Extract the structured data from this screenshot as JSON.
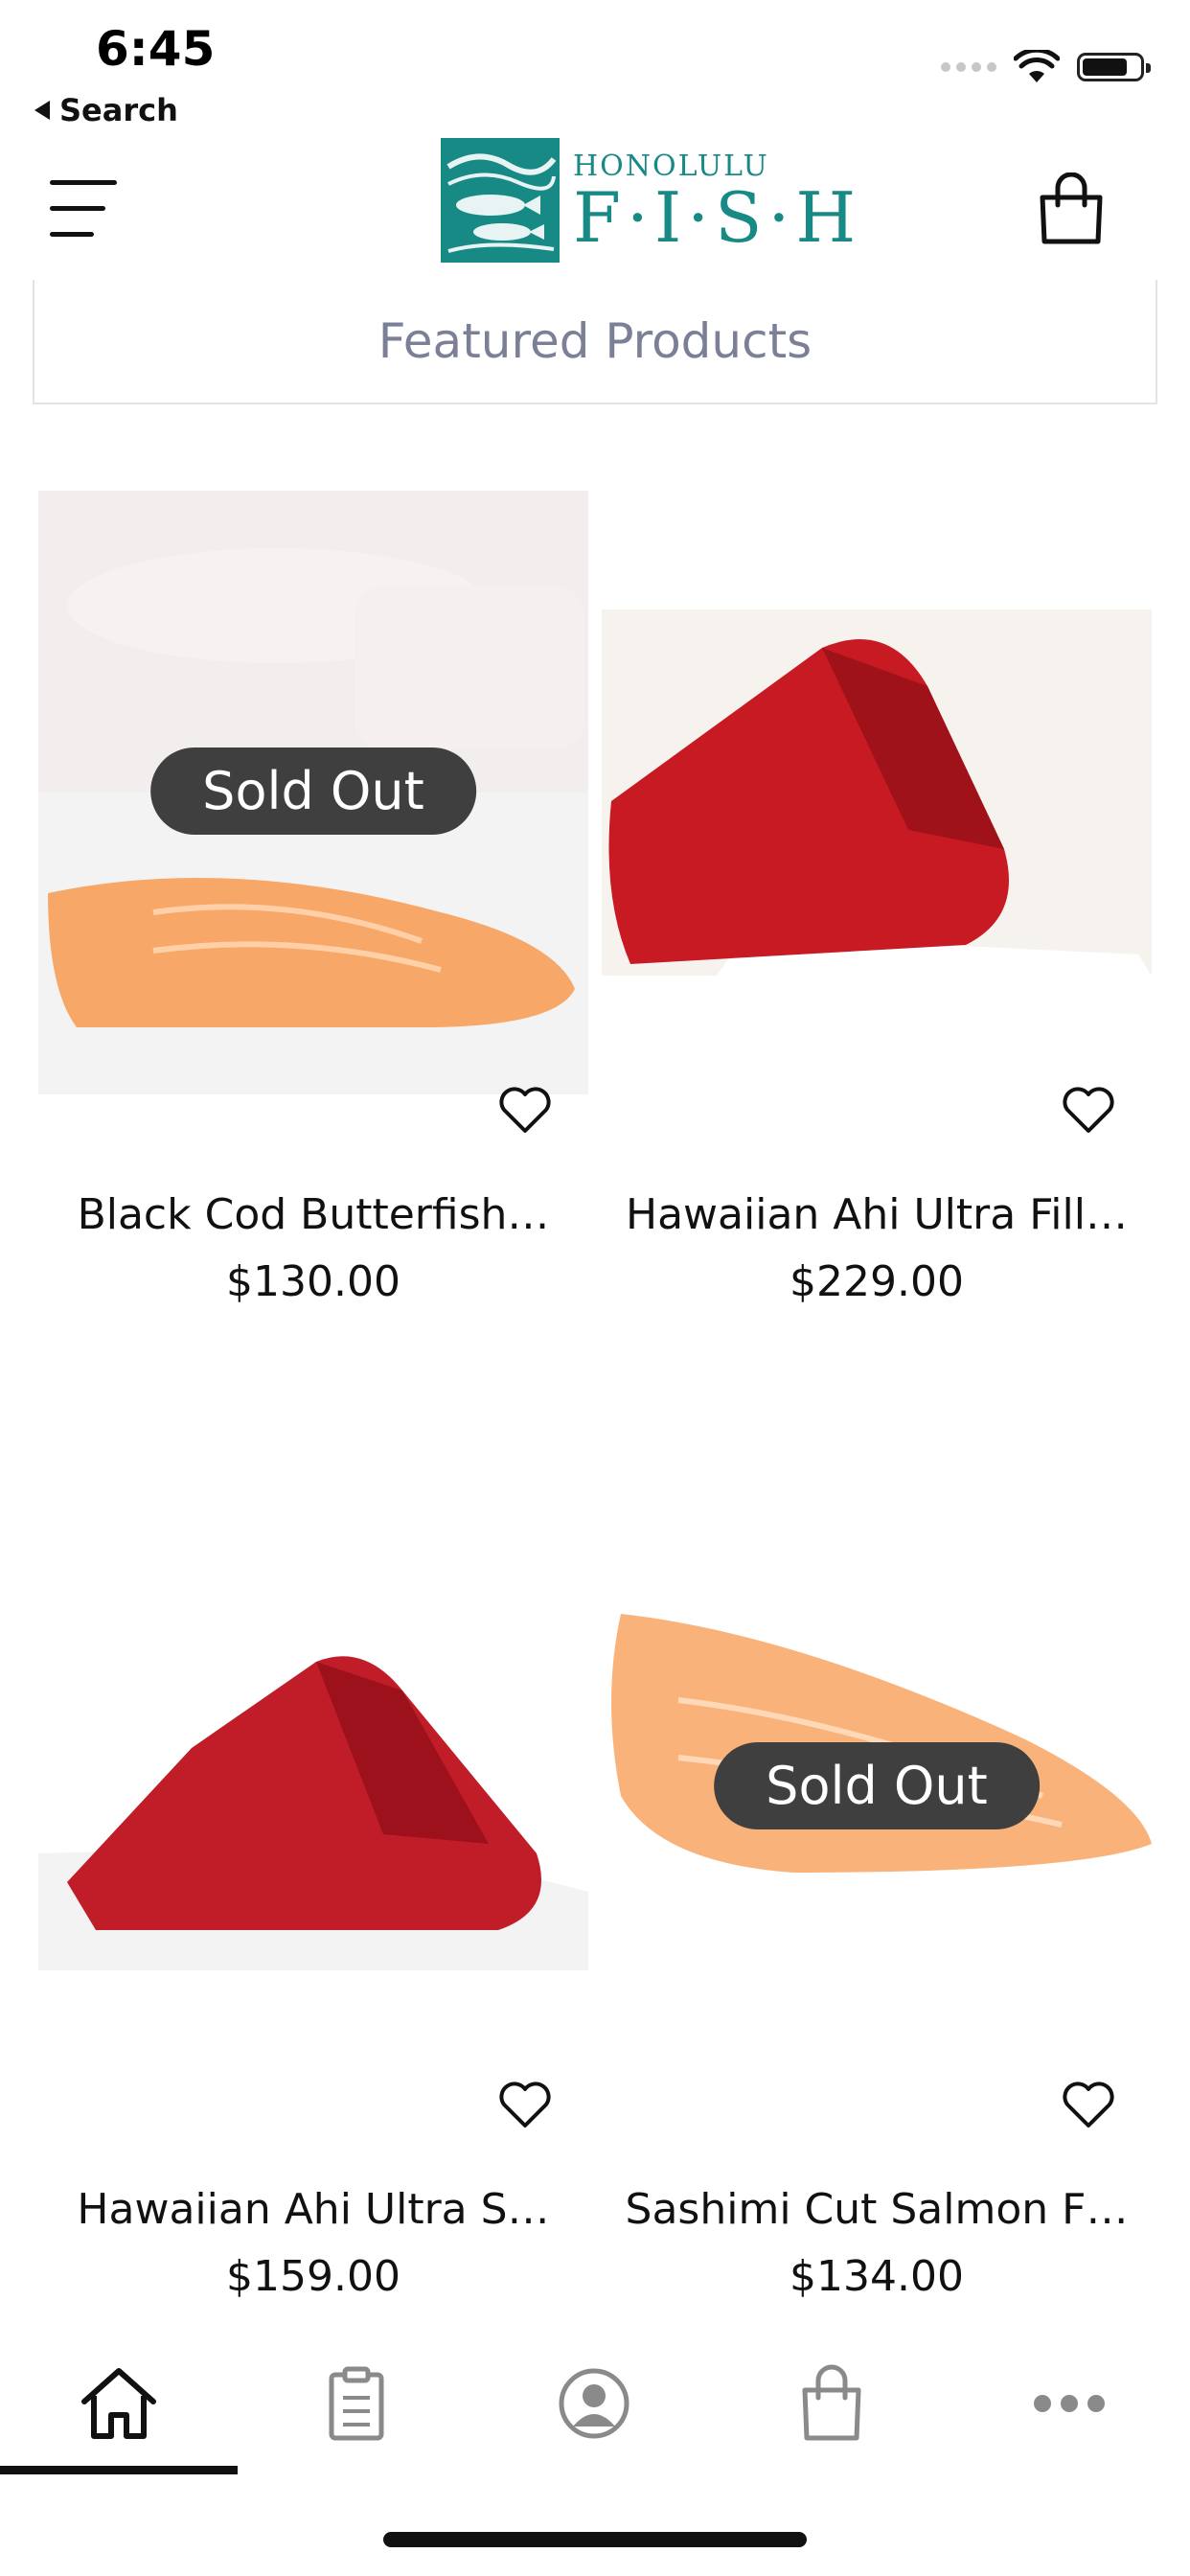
{
  "status": {
    "time": "6:45",
    "back_label": "Search"
  },
  "header": {
    "logo_top": "HONOLULU",
    "logo_bottom": "F·I·S·H"
  },
  "section": {
    "title": "Featured Products"
  },
  "products": [
    {
      "name": "Black Cod Butterfish…",
      "price": "$130.00",
      "badge": "Sold Out",
      "sold_out": true
    },
    {
      "name": "Hawaiian Ahi Ultra Fill…",
      "price": "$229.00",
      "badge": "",
      "sold_out": false
    },
    {
      "name": "Hawaiian Ahi Ultra S…",
      "price": "$159.00",
      "badge": "",
      "sold_out": false
    },
    {
      "name": "Sashimi Cut Salmon F…",
      "price": "$134.00",
      "badge": "Sold Out",
      "sold_out": true
    }
  ],
  "tabs": [
    {
      "icon": "home-icon",
      "active": true
    },
    {
      "icon": "orders-icon",
      "active": false
    },
    {
      "icon": "profile-icon",
      "active": false
    },
    {
      "icon": "bag-icon",
      "active": false
    },
    {
      "icon": "more-icon",
      "active": false
    }
  ],
  "colors": {
    "brand": "#178a86",
    "badge_bg": "#3f3f3f",
    "section_title": "#7c8097"
  }
}
